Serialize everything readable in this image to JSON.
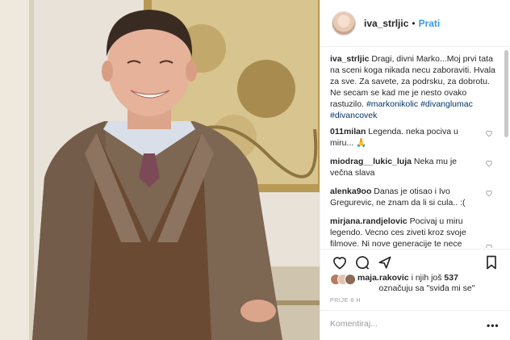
{
  "post": {
    "username": "iva_strljic",
    "separator": "•",
    "follow_label": "Prati"
  },
  "caption": {
    "username": "iva_strljic",
    "text": "Dragi, divni Marko...Moj prvi tata na sceni koga nikada necu zaboraviti. Hvala za sve. Za savete, za podrsku, za dobrotu. Ne secam se kad me je nesto ovako rastuzilo.",
    "hashtags": [
      "#markonikolic",
      "#divanglumac",
      "#divancovek"
    ]
  },
  "comments": [
    {
      "username": "011milan",
      "text": "Legenda. neka pociva u miru... 🙏"
    },
    {
      "username": "miodrag__lukic_luja",
      "text": "Neka mu je večna slava"
    },
    {
      "username": "alenka9oo",
      "text": "Danas je otisao i Ivo Gregurevic, ne znam da li si cula.. :("
    },
    {
      "username": "mirjana.randjelovic",
      "text": "Pocivaj u miru legendo. Vecno ces ziveti kroz svoje filmove. Ni nove generacije te nece zaboraviti. Bices tu kroz svoje uloge. Steta nebsko glumacko pozoriste postaje bogatije za jednog clana , a"
    }
  ],
  "likes": {
    "first_user": "maja.rakovic",
    "connector": "i njih još",
    "count": "537",
    "suffix": "označuju sa \"sviđa mi se\""
  },
  "timestamp": "PRIJE 8 H",
  "comment_input": {
    "placeholder": "Komentiraj..."
  },
  "more_label": "•••",
  "icons": {
    "like": "heart-icon",
    "comment": "comment-icon",
    "share": "share-icon",
    "save": "bookmark-icon",
    "comment_like": "heart-small-icon"
  },
  "colors": {
    "link": "#3897f0",
    "hashtag": "#003569",
    "text": "#262626",
    "muted": "#999999",
    "border": "#efefef"
  }
}
